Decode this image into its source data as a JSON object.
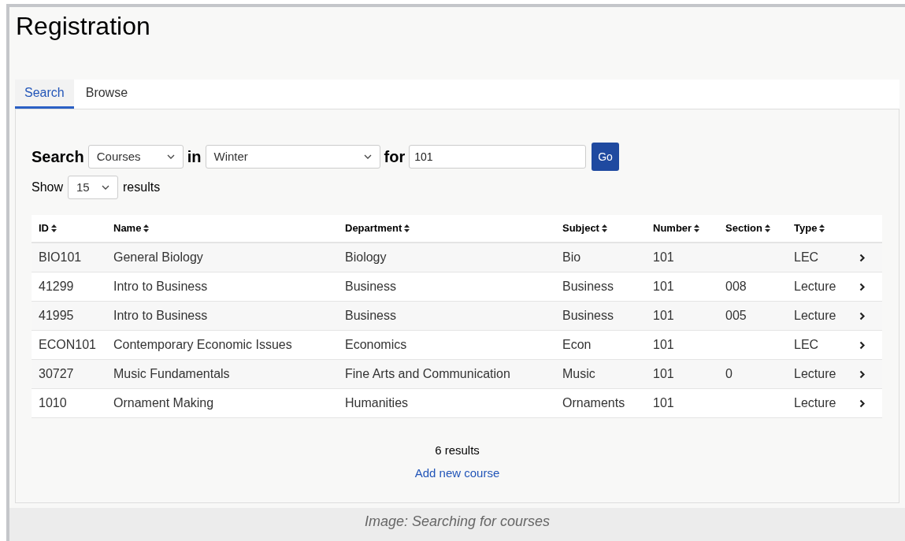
{
  "title": "Registration",
  "tabs": [
    {
      "label": "Search",
      "selected": true
    },
    {
      "label": "Browse",
      "selected": false
    }
  ],
  "search": {
    "label": "Search",
    "type_select": "Courses",
    "in_label": "in",
    "term_select": "Winter",
    "for_label": "for",
    "query": "101",
    "go_button": "Go"
  },
  "show": {
    "label": "Show",
    "count_select": "15",
    "suffix": "results"
  },
  "table": {
    "columns": [
      "ID",
      "Name",
      "Department",
      "Subject",
      "Number",
      "Section",
      "Type"
    ],
    "rows": [
      {
        "cells": [
          "BIO101",
          "General Biology",
          "Biology",
          "Bio",
          "101",
          "",
          "LEC"
        ]
      },
      {
        "cells": [
          "41299",
          "Intro to Business",
          "Business",
          "Business",
          "101",
          "008",
          "Lecture"
        ]
      },
      {
        "cells": [
          "41995",
          "Intro to Business",
          "Business",
          "Business",
          "101",
          "005",
          "Lecture"
        ]
      },
      {
        "cells": [
          "ECON101",
          "Contemporary Economic Issues",
          "Economics",
          "Econ",
          "101",
          "",
          "LEC"
        ]
      },
      {
        "cells": [
          "30727",
          "Music Fundamentals",
          "Fine Arts and Communication",
          "Music",
          "101",
          "0",
          "Lecture"
        ]
      },
      {
        "cells": [
          "1010",
          "Ornament Making",
          "Humanities",
          "Ornaments",
          "101",
          "",
          "Lecture"
        ]
      }
    ]
  },
  "result_count": "6 results",
  "add_link": "Add new course",
  "caption": "Image: Searching for courses"
}
